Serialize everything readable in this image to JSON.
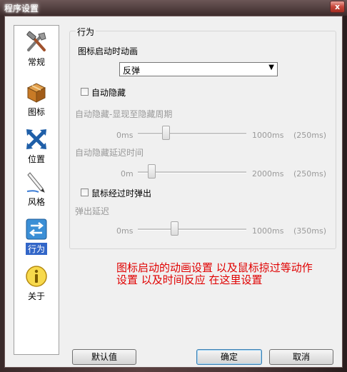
{
  "window": {
    "title": "程序设置",
    "close_label": "x"
  },
  "sidebar": {
    "items": [
      {
        "label": "常规",
        "icon": "tools-icon"
      },
      {
        "label": "图标",
        "icon": "box-icon"
      },
      {
        "label": "位置",
        "icon": "arrows-icon"
      },
      {
        "label": "风格",
        "icon": "pen-icon"
      },
      {
        "label": "行为",
        "icon": "behavior-icon",
        "active": true
      },
      {
        "label": "关于",
        "icon": "info-icon"
      }
    ]
  },
  "behavior": {
    "group_title": "行为",
    "anim_label": "图标启动时动画",
    "anim_value": "反弹",
    "autohide_label": "自动隐藏",
    "autohide_checked": false,
    "show_hide_period": {
      "label": "自动隐藏-显现至隐藏周期",
      "min": "0ms",
      "max": "1000ms",
      "value": "(250ms)",
      "level": 0.25
    },
    "hide_delay": {
      "label": "自动隐藏延迟时间",
      "min": "0m",
      "max": "2000ms",
      "value": "(250ms)",
      "level": 0.125
    },
    "hover_popup_label": "鼠标经过时弹出",
    "hover_popup_checked": false,
    "popup_delay": {
      "label": "弹出延迟",
      "min": "0ms",
      "max": "1000ms",
      "value": "(350ms)",
      "level": 0.35
    }
  },
  "annotation": {
    "line1": "图标启动的动画设置 以及鼠标掠过等动作",
    "line2": "设置 以及时间反应 在这里设置"
  },
  "buttons": {
    "defaults": "默认值",
    "ok": "确定",
    "cancel": "取消"
  }
}
